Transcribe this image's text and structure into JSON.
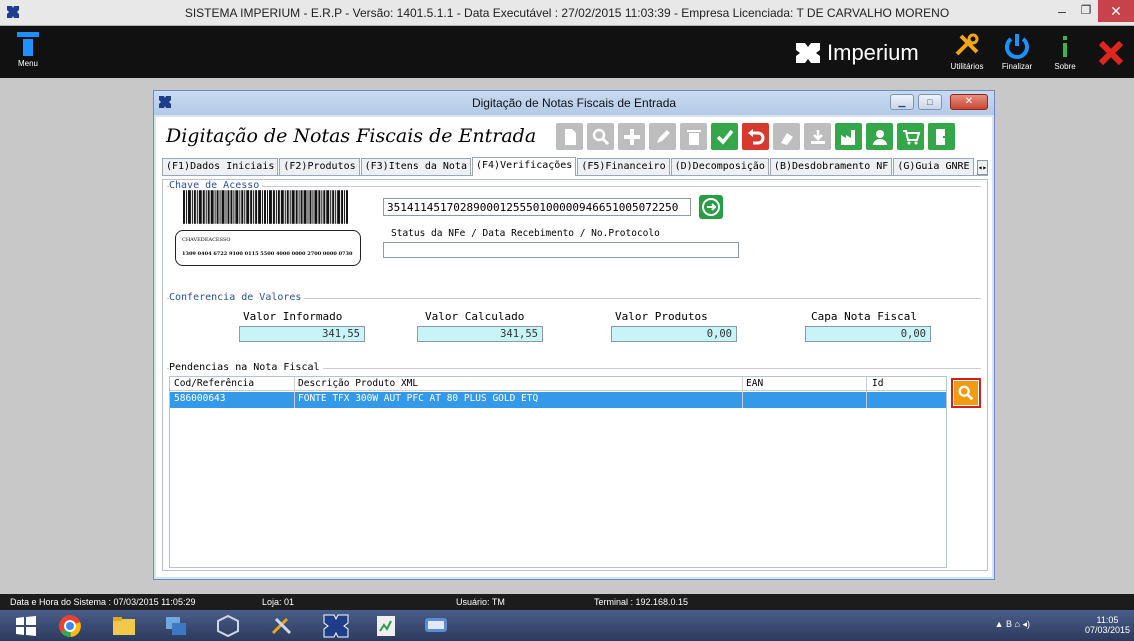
{
  "os_title": "SISTEMA IMPERIUM - E.R.P - Versão: 1401.5.1.1 - Data Executável : 27/02/2015 11:03:39 - Empresa Licenciada: T DE CARVALHO MORENO",
  "header": {
    "menu_label": "Menu",
    "brand": "Imperium",
    "buttons": {
      "utilities": "Utilitários",
      "finish": "Finalizar",
      "about": "Sobre"
    }
  },
  "modal": {
    "title": "Digitação de Notas Fiscais de Entrada",
    "heading": "Digitação de Notas Fiscais de Entrada",
    "toolbar_icons": [
      "document-icon",
      "search-icon",
      "add-icon",
      "edit-icon",
      "delete-icon",
      "confirm-icon",
      "undo-icon",
      "clear-icon",
      "download-icon",
      "factory-icon",
      "user-icon",
      "cart-icon",
      "exit-icon"
    ],
    "tabs": [
      "(F1)Dados Iniciais",
      "(F2)Produtos",
      "(F3)Itens da Nota",
      "(F4)Verificações",
      "(F5)Financeiro",
      "(D)Decomposição",
      "(B)Desdobramento NF",
      "(G)Guia GNRE"
    ],
    "active_tab": "(F4)Verificações"
  },
  "chave": {
    "legend": "Chave de Acesso",
    "barcode_caption": "CHAVEDEACESSO",
    "barcode_number": "1309 0404 6722 9100 0115 5500 4000 0000 2700 0000 0730",
    "key_value": "35141145170289000125550100000946651005072250",
    "status_label": "Status da NFe / Data Recebimento / No.Protocolo",
    "status_value": ""
  },
  "conferencia": {
    "legend": "Conferencia de Valores",
    "fields": [
      {
        "label": "Valor Informado",
        "value": "341,55"
      },
      {
        "label": "Valor Calculado",
        "value": "341,55"
      },
      {
        "label": "Valor Produtos",
        "value": "0,00"
      },
      {
        "label": "Capa Nota Fiscal",
        "value": "0,00"
      }
    ]
  },
  "pendencias": {
    "legend": "Pendencias na Nota Fiscal",
    "columns": [
      "Cod/Referência",
      "Descrição Produto XML",
      "EAN",
      "Id"
    ],
    "rows": [
      {
        "cod": "586000643",
        "descricao": "FONTE TFX 300W AUT PFC AT 80 PLUS GOLD ETQ",
        "ean": "",
        "id": ""
      }
    ]
  },
  "statusbar": {
    "datetime": "Data e Hora do Sistema :  07/03/2015 11:05:29",
    "loja": "Loja:  01",
    "usuario": "Usuário:  TM",
    "terminal": "Terminal :  192.168.0.15"
  },
  "tray": {
    "time": "11:05",
    "date": "07/03/2015"
  },
  "colors": {
    "accent_green": "#35a64a",
    "selected_row": "#3399e8",
    "readonly_field": "#c8f3f7",
    "search_orange": "#f29b11"
  }
}
